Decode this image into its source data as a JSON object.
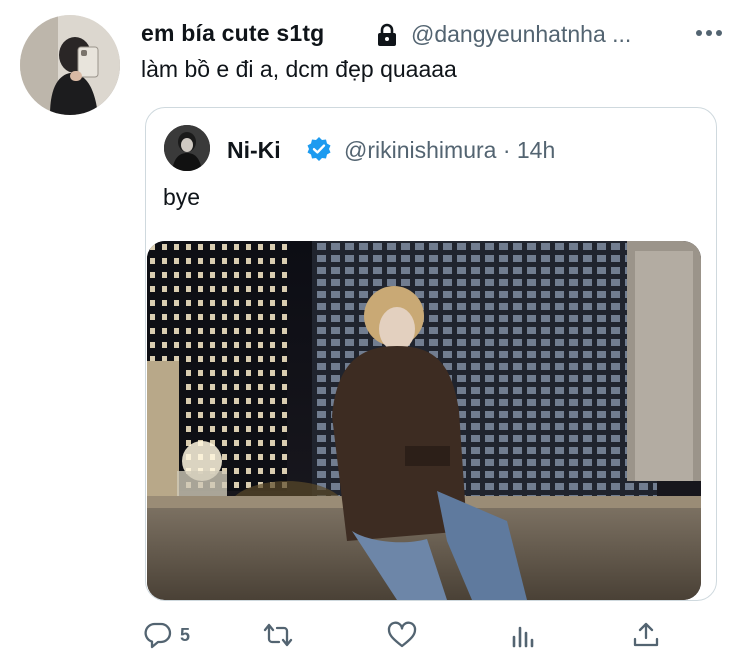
{
  "tweet": {
    "display_name": "em bía cute s1tg",
    "handle": "@dangyeunhatnha ...",
    "text": "làm bồ e đi a, dcm đẹp quaaaa",
    "avatar_icon": "profile-photo"
  },
  "quoted_tweet": {
    "display_name": "Ni-Ki",
    "handle": "@rikinishimura · 14h",
    "text": "bye",
    "photo": "night-city-photo"
  },
  "actions": {
    "reply_count": "5"
  },
  "colors": {
    "text": "#0f1419",
    "secondary": "#536471",
    "verified": "#1d9bf0",
    "border": "#cfd9de",
    "icon": "#536471"
  }
}
